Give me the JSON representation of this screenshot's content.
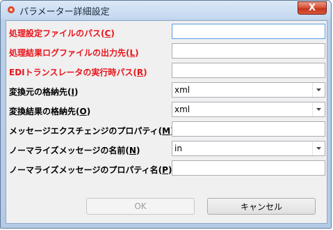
{
  "window": {
    "title": "パラメーター詳細設定",
    "close_label": "X"
  },
  "form": {
    "rows": [
      {
        "label": "処理設定ファイルのパス(",
        "mnemonic": "C",
        "suffix": ")",
        "required": true,
        "type": "text",
        "value": ""
      },
      {
        "label": "処理結果ログファイルの出力先(",
        "mnemonic": "L",
        "suffix": ")",
        "required": true,
        "type": "text",
        "value": ""
      },
      {
        "label": "EDIトランスレータの実行時パス(",
        "mnemonic": "R",
        "suffix": ")",
        "required": true,
        "type": "text",
        "value": ""
      },
      {
        "label": "変換元の格納先(",
        "mnemonic": "I",
        "suffix": ")",
        "required": false,
        "type": "select",
        "value": "xml"
      },
      {
        "label": "変換結果の格納先(",
        "mnemonic": "O",
        "suffix": ")",
        "required": false,
        "type": "select",
        "value": "xml"
      },
      {
        "label": "メッセージエクスチェンジのプロパティ(",
        "mnemonic": "M",
        "suffix": ")",
        "required": false,
        "type": "text",
        "value": ""
      },
      {
        "label": "ノーマライズメッセージの名前(",
        "mnemonic": "N",
        "suffix": ")",
        "required": false,
        "type": "select",
        "value": "in"
      },
      {
        "label": "ノーマライズメッセージのプロパティ名(",
        "mnemonic": "P",
        "suffix": ")",
        "required": false,
        "type": "text",
        "value": ""
      }
    ]
  },
  "buttons": {
    "ok_label": "OK",
    "cancel_label": "キャンセル"
  },
  "colors": {
    "required_label": "#e8141b",
    "close_button": "#c4341c"
  }
}
